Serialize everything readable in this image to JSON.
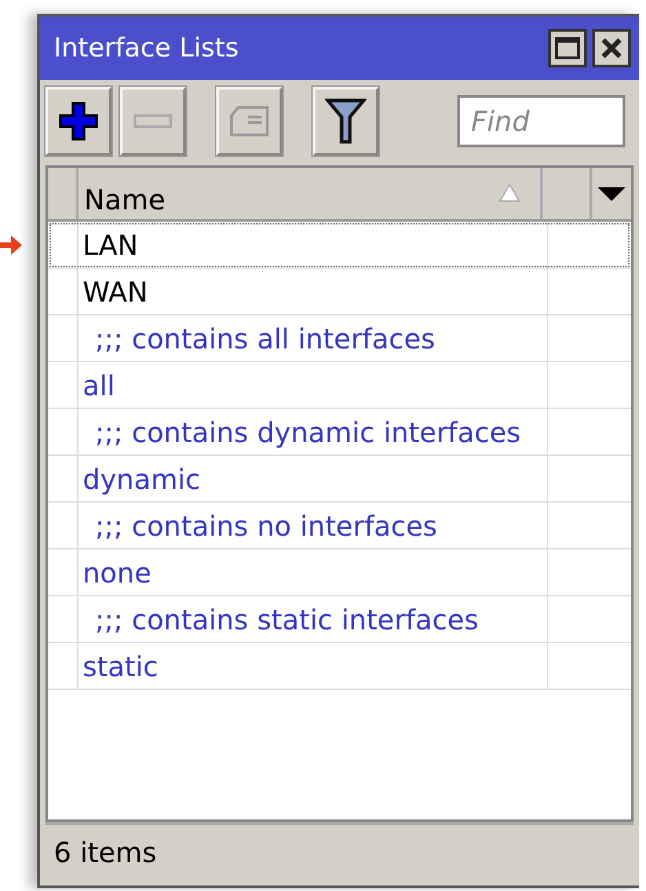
{
  "window": {
    "title": "Interface Lists"
  },
  "search": {
    "placeholder": "Find"
  },
  "table": {
    "columns": [
      "Name"
    ],
    "rows": [
      {
        "kind": "entry",
        "text": "LAN",
        "color": "#000000",
        "selected": true
      },
      {
        "kind": "entry",
        "text": "WAN",
        "color": "#000000",
        "selected": false
      },
      {
        "kind": "comment",
        "text": ";;; contains all interfaces",
        "color": "#3535c0",
        "selected": false
      },
      {
        "kind": "entry",
        "text": "all",
        "color": "#3535c0",
        "selected": false
      },
      {
        "kind": "comment",
        "text": ";;; contains dynamic interfaces",
        "color": "#3535c0",
        "selected": false
      },
      {
        "kind": "entry",
        "text": "dynamic",
        "color": "#3535c0",
        "selected": false
      },
      {
        "kind": "comment",
        "text": ";;; contains no interfaces",
        "color": "#3535c0",
        "selected": false
      },
      {
        "kind": "entry",
        "text": "none",
        "color": "#3535c0",
        "selected": false
      },
      {
        "kind": "comment",
        "text": ";;; contains static interfaces",
        "color": "#3535c0",
        "selected": false
      },
      {
        "kind": "entry",
        "text": "static",
        "color": "#3535c0",
        "selected": false
      }
    ]
  },
  "status_bar": "6 items"
}
